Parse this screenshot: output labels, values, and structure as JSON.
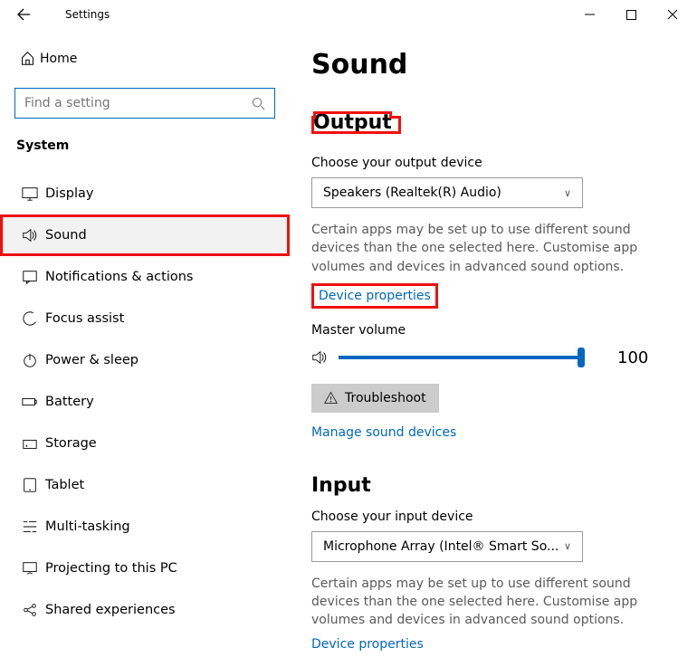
{
  "titlebar": {
    "title": "Settings"
  },
  "sidebar": {
    "home": "Home",
    "search_placeholder": "Find a setting",
    "section": "System",
    "items": [
      {
        "label": "Display"
      },
      {
        "label": "Sound"
      },
      {
        "label": "Notifications & actions"
      },
      {
        "label": "Focus assist"
      },
      {
        "label": "Power & sleep"
      },
      {
        "label": "Battery"
      },
      {
        "label": "Storage"
      },
      {
        "label": "Tablet"
      },
      {
        "label": "Multi-tasking"
      },
      {
        "label": "Projecting to this PC"
      },
      {
        "label": "Shared experiences"
      }
    ]
  },
  "main": {
    "page_title": "Sound",
    "output": {
      "heading": "Output",
      "choose_label": "Choose your output device",
      "device": "Speakers (Realtek(R) Audio)",
      "description": "Certain apps may be set up to use different sound devices than the one selected here. Customise app volumes and devices in advanced sound options.",
      "device_props_link": "Device properties",
      "master_label": "Master volume",
      "master_value": "100",
      "troubleshoot": "Troubleshoot",
      "manage_link": "Manage sound devices"
    },
    "input": {
      "heading": "Input",
      "choose_label": "Choose your input device",
      "device": "Microphone Array (Intel® Smart So...",
      "description": "Certain apps may be set up to use different sound devices than the one selected here. Customise app volumes and devices in advanced sound options.",
      "device_props_link": "Device properties"
    }
  }
}
